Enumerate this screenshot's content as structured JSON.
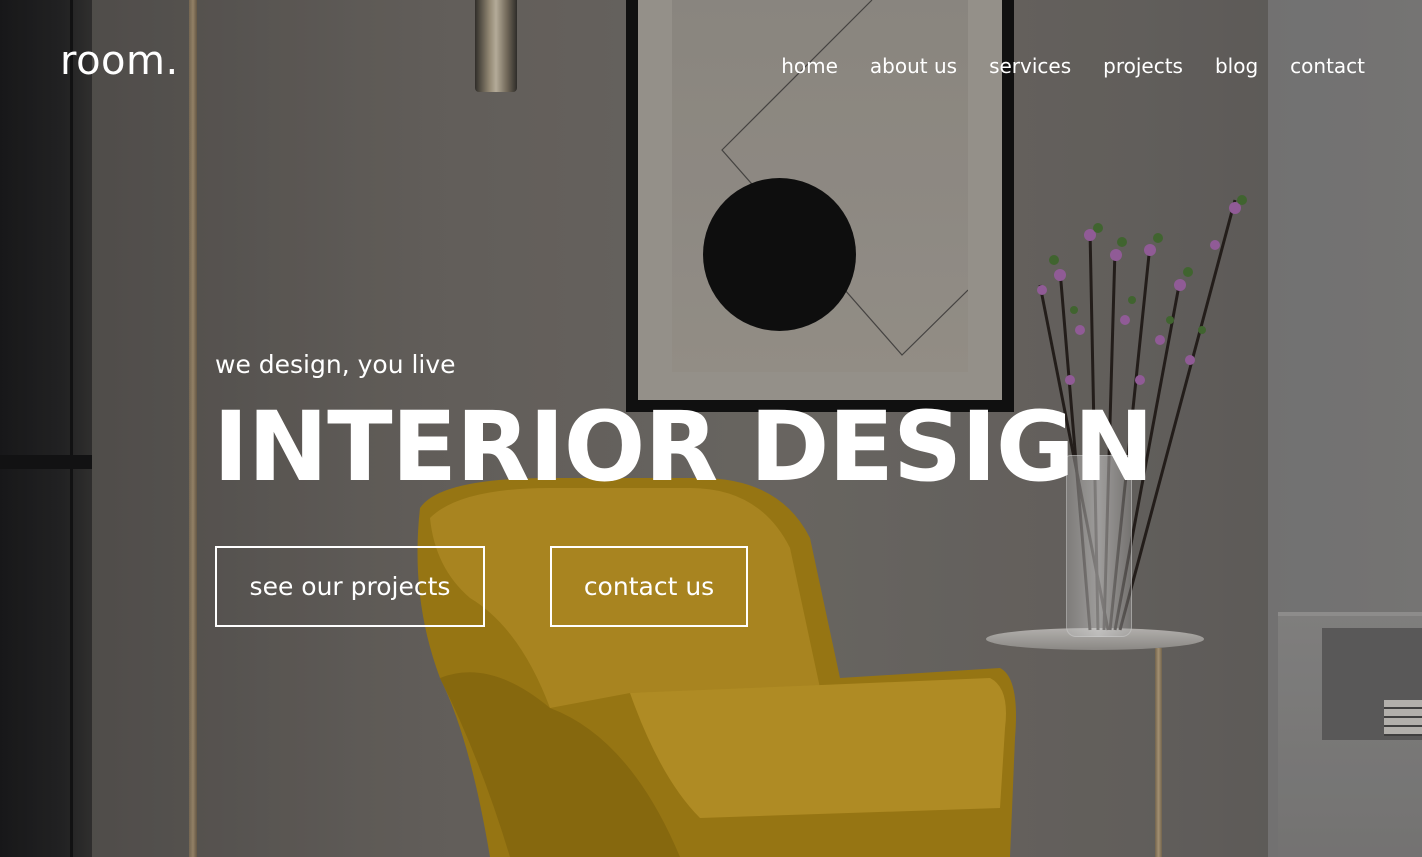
{
  "brand": {
    "logo": "room."
  },
  "nav": {
    "items": [
      {
        "label": "home"
      },
      {
        "label": "about us"
      },
      {
        "label": "services"
      },
      {
        "label": "projects"
      },
      {
        "label": "blog"
      },
      {
        "label": "contact"
      }
    ]
  },
  "hero": {
    "tagline": "we design, you live",
    "headline": "INTERIOR DESIGN",
    "primary_button": "see our projects",
    "secondary_button": "contact us"
  },
  "colors": {
    "text": "#ffffff",
    "chair": "#c29a1e",
    "wall": "#7a7671",
    "frame": "#141414"
  }
}
